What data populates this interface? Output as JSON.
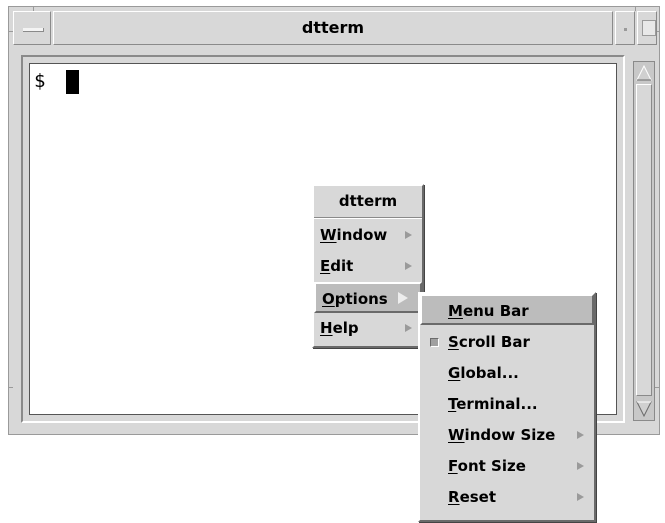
{
  "window": {
    "title": "dtterm"
  },
  "terminal": {
    "prompt": "$"
  },
  "popup_menu": {
    "title": "dtterm",
    "items": [
      {
        "mnemonic": "W",
        "rest": "indow",
        "has_submenu": true
      },
      {
        "mnemonic": "E",
        "rest": "dit",
        "has_submenu": true
      },
      {
        "mnemonic": "O",
        "rest": "ptions",
        "has_submenu": true,
        "selected": true
      },
      {
        "mnemonic": "H",
        "rest": "elp",
        "has_submenu": true
      }
    ]
  },
  "options_submenu": {
    "items": [
      {
        "mnemonic": "M",
        "rest": "enu Bar",
        "selected": true
      },
      {
        "mnemonic": "S",
        "rest": "croll Bar",
        "toggle": true
      },
      {
        "mnemonic": "G",
        "rest": "lobal..."
      },
      {
        "mnemonic": "T",
        "rest": "erminal..."
      },
      {
        "mnemonic": "W",
        "rest": "indow Size",
        "has_submenu": true
      },
      {
        "mnemonic": "F",
        "rest": "ont Size",
        "has_submenu": true
      },
      {
        "mnemonic": "R",
        "rest": "eset",
        "has_submenu": true
      }
    ]
  },
  "icons": {
    "window_menu": "window-menu-icon",
    "minimize": "minimize-icon",
    "maximize": "maximize-icon",
    "scroll_up": "scroll-up-arrow-icon",
    "scroll_down": "scroll-down-arrow-icon",
    "cascade": "cascade-arrow-icon",
    "toggle": "toggle-indicator-icon"
  },
  "colors": {
    "frame": "#d8d8d8",
    "terminal_bg": "#ffffff",
    "selected_item": "#bcbcbc"
  }
}
